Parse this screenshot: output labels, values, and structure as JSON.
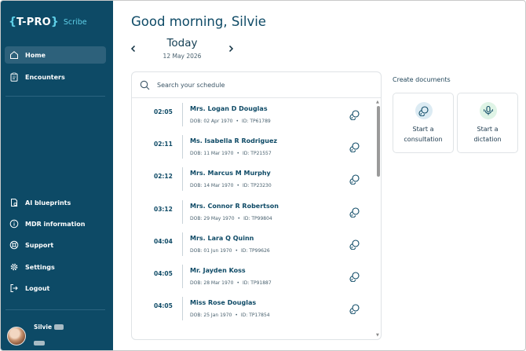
{
  "app": {
    "logo_brace_open": "{",
    "logo_word": "T-PRO",
    "logo_brace_close": "}",
    "logo_product": "Scribe"
  },
  "sidebar": {
    "top_items": [
      {
        "label": "Home",
        "icon": "home-icon",
        "active": true
      },
      {
        "label": "Encounters",
        "icon": "clipboard-icon",
        "active": false
      }
    ],
    "bottom_items": [
      {
        "label": "AI blueprints",
        "icon": "blueprint-icon"
      },
      {
        "label": "MDR information",
        "icon": "info-icon"
      },
      {
        "label": "Support",
        "icon": "lifebuoy-icon"
      },
      {
        "label": "Settings",
        "icon": "gear-icon"
      },
      {
        "label": "Logout",
        "icon": "logout-icon"
      }
    ],
    "user": {
      "name": "Silvie"
    }
  },
  "main": {
    "greeting": "Good morning, Silvie",
    "date_nav": {
      "title": "Today",
      "date": "12 May 2026",
      "prev_icon": "chevron-left-icon",
      "next_icon": "chevron-right-icon"
    }
  },
  "schedule": {
    "search_placeholder": "Search your schedule",
    "appointments": [
      {
        "time": "02:05",
        "name": "Mrs. Logan D Douglas",
        "dob": "DOB: 02 Apr 1970",
        "id": "ID: TP61789"
      },
      {
        "time": "02:11",
        "name": "Ms. Isabella R Rodriguez",
        "dob": "DOB: 11 Mar 1970",
        "id": "ID: TP21557"
      },
      {
        "time": "02:12",
        "name": "Mrs. Marcus M Murphy",
        "dob": "DOB: 14 Mar 1970",
        "id": "ID: TP23230"
      },
      {
        "time": "03:12",
        "name": "Mrs. Connor R Robertson",
        "dob": "DOB: 29 May 1970",
        "id": "ID: TP99804"
      },
      {
        "time": "04:04",
        "name": "Mrs. Lara Q Quinn",
        "dob": "DOB: 01 Jun 1970",
        "id": "ID: TP99626"
      },
      {
        "time": "04:05",
        "name": "Mr. Jayden Koss",
        "dob": "DOB: 28 Mar 1970",
        "id": "ID: TP91887"
      },
      {
        "time": "04:05",
        "name": "Miss Rose Douglas",
        "dob": "DOB: 25 Jan 1970",
        "id": "ID: TP17854"
      }
    ],
    "meta_separator": "•"
  },
  "create_documents": {
    "title": "Create documents",
    "cards": [
      {
        "line1": "Start a",
        "line2": "consultation",
        "icon": "chat-bubbles-icon",
        "icon_bg": "#dcebf3"
      },
      {
        "line1": "Start a",
        "line2": "dictation",
        "icon": "microphone-icon",
        "icon_bg": "#dff4e6"
      }
    ]
  },
  "colors": {
    "sidebar": "#0d4a66",
    "sidebar_active": "#2d617b",
    "accent_text": "#0e4a66",
    "logo_accent": "#5fd0e8"
  }
}
